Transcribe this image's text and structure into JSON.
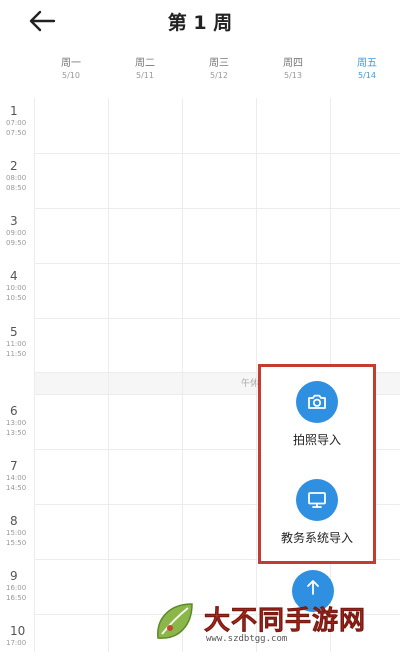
{
  "header": {
    "title": "第 1 周"
  },
  "days": [
    {
      "name": "周一",
      "date": "5/10",
      "active": false
    },
    {
      "name": "周二",
      "date": "5/11",
      "active": false
    },
    {
      "name": "周三",
      "date": "5/12",
      "active": false
    },
    {
      "name": "周四",
      "date": "5/13",
      "active": false
    },
    {
      "name": "周五",
      "date": "5/14",
      "active": true
    }
  ],
  "periods": [
    {
      "num": "1",
      "start": "07:00",
      "end": "07:50"
    },
    {
      "num": "2",
      "start": "08:00",
      "end": "08:50"
    },
    {
      "num": "3",
      "start": "09:00",
      "end": "09:50"
    },
    {
      "num": "4",
      "start": "10:00",
      "end": "10:50"
    },
    {
      "num": "5",
      "start": "11:00",
      "end": "11:50"
    },
    {
      "num": "6",
      "start": "13:00",
      "end": "13:50"
    },
    {
      "num": "7",
      "start": "14:00",
      "end": "14:50"
    },
    {
      "num": "8",
      "start": "15:00",
      "end": "15:50"
    },
    {
      "num": "9",
      "start": "16:00",
      "end": "16:50"
    },
    {
      "num": "10",
      "start": "17:00",
      "end": ""
    }
  ],
  "lunch_label": "午休",
  "import_menu": {
    "photo_label": "拍照导入",
    "system_label": "教务系统导入"
  },
  "colors": {
    "accent": "#2f8fe0",
    "highlight_border": "#c43b32",
    "active_day": "#3b9be2"
  },
  "watermark": {
    "text": "大不同手游网",
    "url": "www.szdbtgg.com"
  }
}
